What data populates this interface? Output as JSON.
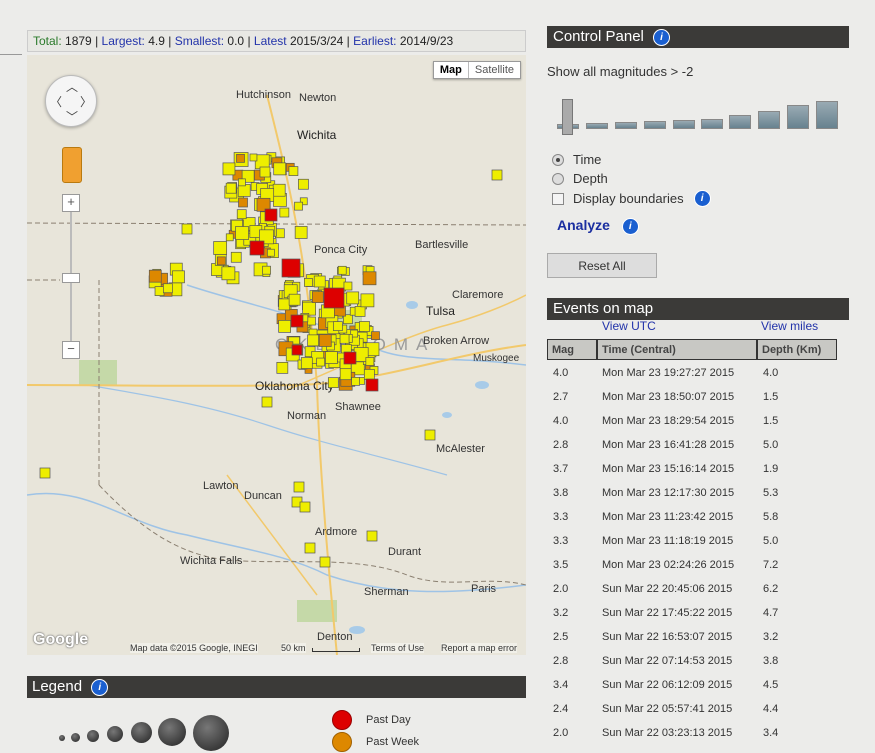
{
  "stats": {
    "total_label": "Total:",
    "total": "1879",
    "largest_label": "Largest:",
    "largest": "4.9",
    "smallest_label": "Smallest:",
    "smallest": "0.0",
    "latest_label": "Latest",
    "latest": "2015/3/24",
    "earliest_label": "Earliest:",
    "earliest": "2014/9/23"
  },
  "map": {
    "type_map": "Map",
    "type_satellite": "Satellite",
    "state_label": "OKLAHOMA",
    "cities": {
      "hutchinson": "Hutchinson",
      "newton": "Newton",
      "wichita": "Wichita",
      "ponca_city": "Ponca City",
      "bartlesville": "Bartlesville",
      "claremore": "Claremore",
      "tulsa": "Tulsa",
      "broken_arrow": "Broken Arrow",
      "muskogee": "Muskogee",
      "oklahoma_city": "Oklahoma City",
      "shawnee": "Shawnee",
      "norman": "Norman",
      "mcalester": "McAlester",
      "lawton": "Lawton",
      "duncan": "Duncan",
      "ardmore": "Ardmore",
      "durant": "Durant",
      "wichita_falls": "Wichita Falls",
      "sherman": "Sherman",
      "paris": "Paris",
      "denton": "Denton"
    },
    "footer": {
      "data": "Map data ©2015 Google, INEGI",
      "scale": "50 km",
      "terms": "Terms of Use",
      "report": "Report a map error"
    },
    "logo": "Google"
  },
  "legend": {
    "title": "Legend",
    "past_day": "Past Day",
    "past_week": "Past Week",
    "colors": {
      "past_day": "#dd0000",
      "past_week": "#dd8800",
      "older": "#eeee00"
    }
  },
  "control_panel": {
    "title": "Control Panel",
    "magnitude_label": "Show all magnitudes > -2",
    "time_label": "Time",
    "depth_label": "Depth",
    "boundaries_label": "Display boundaries",
    "analyze_label": "Analyze",
    "reset_label": "Reset All"
  },
  "events": {
    "title": "Events on map",
    "view_utc": "View UTC",
    "view_miles": "View miles",
    "columns": [
      "Mag",
      "Time (Central)",
      "Depth (Km)"
    ],
    "rows": [
      [
        "4.0",
        "Mon Mar 23 19:27:27 2015",
        "4.0"
      ],
      [
        "2.7",
        "Mon Mar 23 18:50:07 2015",
        "1.5"
      ],
      [
        "4.0",
        "Mon Mar 23 18:29:54 2015",
        "1.5"
      ],
      [
        "2.8",
        "Mon Mar 23 16:41:28 2015",
        "5.0"
      ],
      [
        "3.7",
        "Mon Mar 23 15:16:14 2015",
        "1.9"
      ],
      [
        "3.8",
        "Mon Mar 23 12:17:30 2015",
        "5.3"
      ],
      [
        "3.3",
        "Mon Mar 23 11:23:42 2015",
        "5.8"
      ],
      [
        "3.3",
        "Mon Mar 23 11:18:19 2015",
        "5.0"
      ],
      [
        "3.5",
        "Mon Mar 23 02:24:26 2015",
        "7.2"
      ],
      [
        "2.0",
        "Sun Mar 22 20:45:06 2015",
        "6.2"
      ],
      [
        "3.2",
        "Sun Mar 22 17:45:22 2015",
        "4.7"
      ],
      [
        "2.5",
        "Sun Mar 22 16:53:07 2015",
        "3.2"
      ],
      [
        "2.8",
        "Sun Mar 22 07:14:53 2015",
        "3.8"
      ],
      [
        "3.4",
        "Sun Mar 22 06:12:09 2015",
        "4.5"
      ],
      [
        "2.4",
        "Sun Mar 22 05:57:41 2015",
        "4.4"
      ],
      [
        "2.0",
        "Sun Mar 22 03:23:13 2015",
        "3.4"
      ]
    ]
  }
}
